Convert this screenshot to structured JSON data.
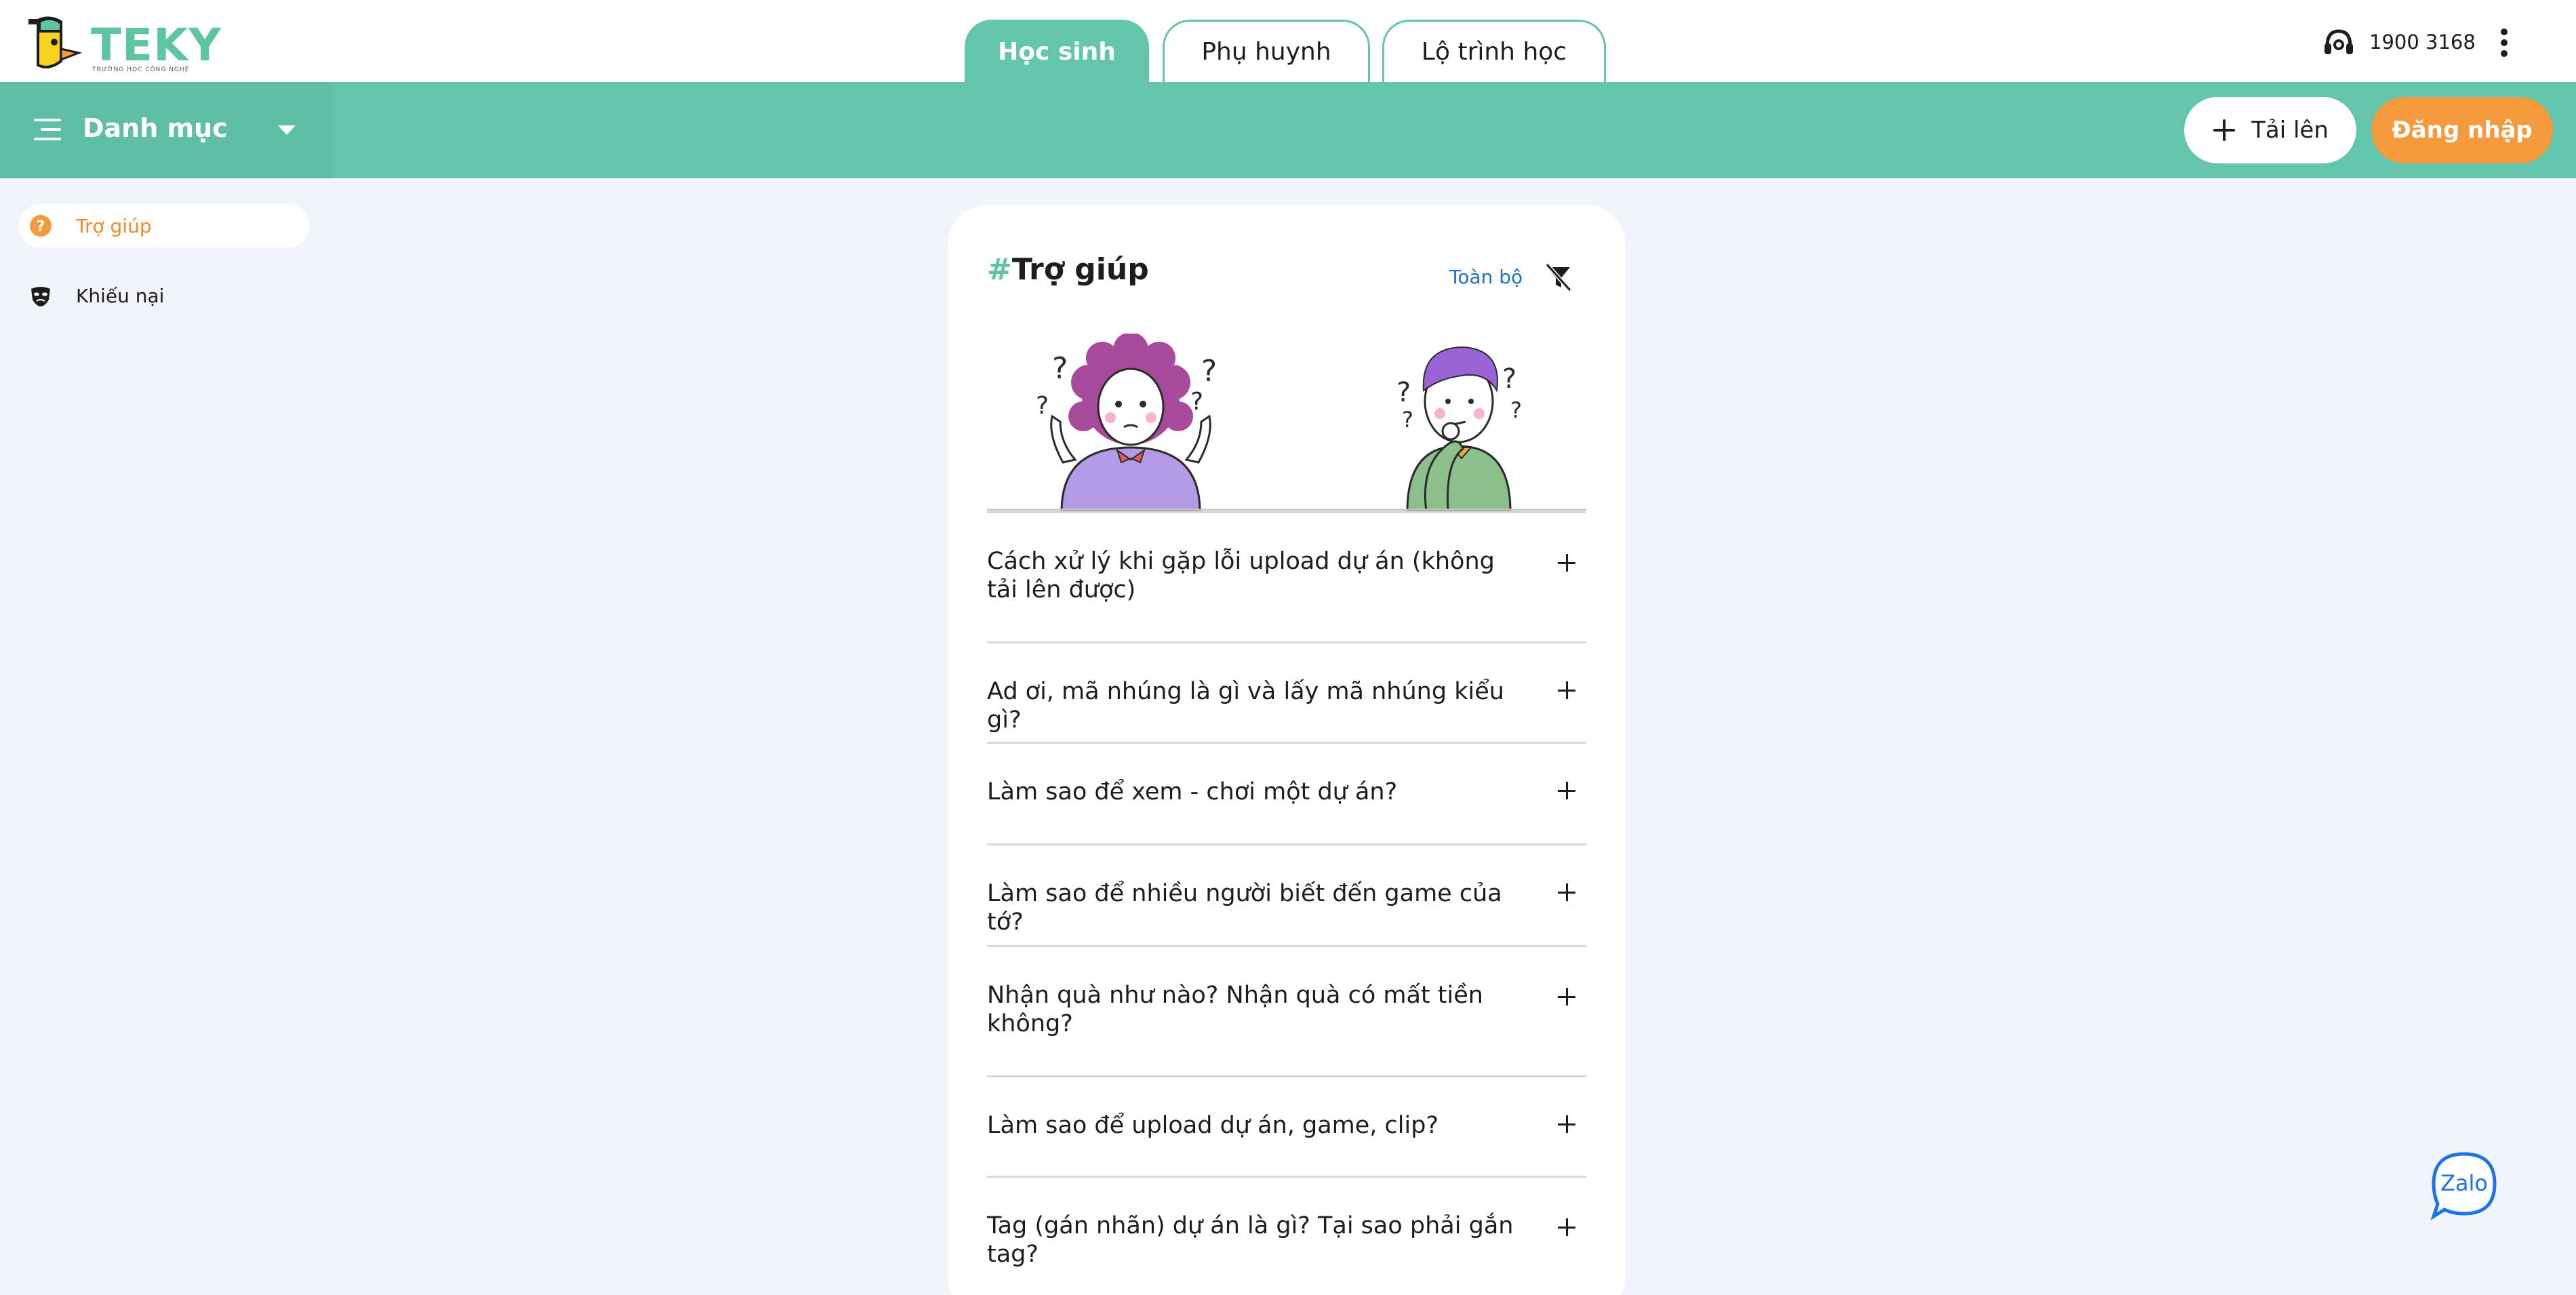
{
  "brand": {
    "logo_text": "TEKY",
    "logo_sub": "TRƯỜNG HỌC CÔNG NGHỆ"
  },
  "tabs": [
    {
      "label": "Học sinh",
      "active": true
    },
    {
      "label": "Phụ huynh",
      "active": false
    },
    {
      "label": "Lộ trình học",
      "active": false
    }
  ],
  "header": {
    "hotline": "1900 3168",
    "hotline_icon": "headset-icon",
    "menu_icon": "more-vertical-icon"
  },
  "category_bar": {
    "label": "Danh mục",
    "icon": "menu-lines-icon",
    "caret": "caret-down-icon"
  },
  "actions": {
    "upload_label": "Tải lên",
    "login_label": "Đăng nhập"
  },
  "sidebar": {
    "items": [
      {
        "label": "Trợ giúp",
        "icon": "help-circle-icon",
        "active": true
      },
      {
        "label": "Khiếu nại",
        "icon": "mask-icon",
        "active": false
      }
    ]
  },
  "help": {
    "hash": "#",
    "title": "Trợ giúp",
    "filter_label": "Toàn bộ",
    "filter_icon": "filter-off-icon",
    "faqs": [
      {
        "question": "Cách xử lý khi gặp lỗi upload dự án (không tải lên được)"
      },
      {
        "question": "Ad ơi, mã nhúng là gì và lấy mã nhúng kiểu gì?"
      },
      {
        "question": "Làm sao để xem - chơi một dự án?"
      },
      {
        "question": "Làm sao để nhiều người biết đến game của tớ?"
      },
      {
        "question": "Nhận quà như nào? Nhận quà có mất tiền không?"
      },
      {
        "question": "Làm sao để upload dự án, game, clip?"
      },
      {
        "question": "Tag (gán nhãn) dự án là gì? Tại sao phải gắn tag?"
      }
    ]
  },
  "zalo": {
    "label": "Zalo"
  },
  "colors": {
    "primary": "#64c5ad",
    "accent": "#f39a3c",
    "link": "#1e6fd0",
    "background": "#f1f4fa"
  }
}
